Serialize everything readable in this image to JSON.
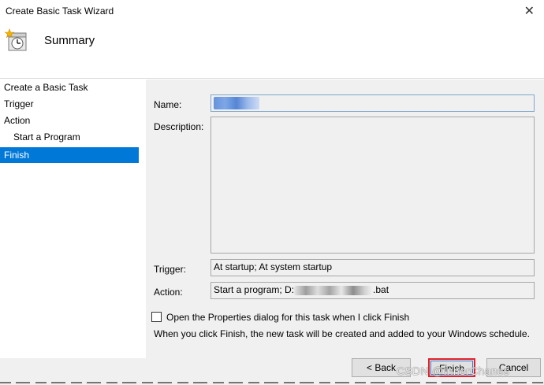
{
  "window": {
    "title": "Create Basic Task Wizard",
    "close_glyph": "✕"
  },
  "header": {
    "heading": "Summary",
    "icon": "task-clock-icon"
  },
  "sidebar": {
    "items": [
      {
        "label": "Create a Basic Task"
      },
      {
        "label": "Trigger"
      },
      {
        "label": "Action"
      },
      {
        "label": "Start a Program"
      },
      {
        "label": "Finish"
      }
    ]
  },
  "form": {
    "name_label": "Name:",
    "description_label": "Description:",
    "description_value": "",
    "trigger_label": "Trigger:",
    "trigger_value": "At startup; At system startup",
    "action_label": "Action:",
    "action_prefix": "Start a program; D:",
    "action_suffix": ".bat"
  },
  "options": {
    "checkbox_label": "Open the Properties dialog for this task when I click Finish",
    "checkbox_checked": false,
    "info_text": "When you click Finish, the new task will be created and added to your Windows schedule."
  },
  "buttons": {
    "back": "< Back",
    "finish": "Finish",
    "cancel": "Cancel"
  },
  "watermark": "CSDN @InnerChanes",
  "colors": {
    "selection": "#0078d7",
    "highlight_box": "#e0222c"
  }
}
